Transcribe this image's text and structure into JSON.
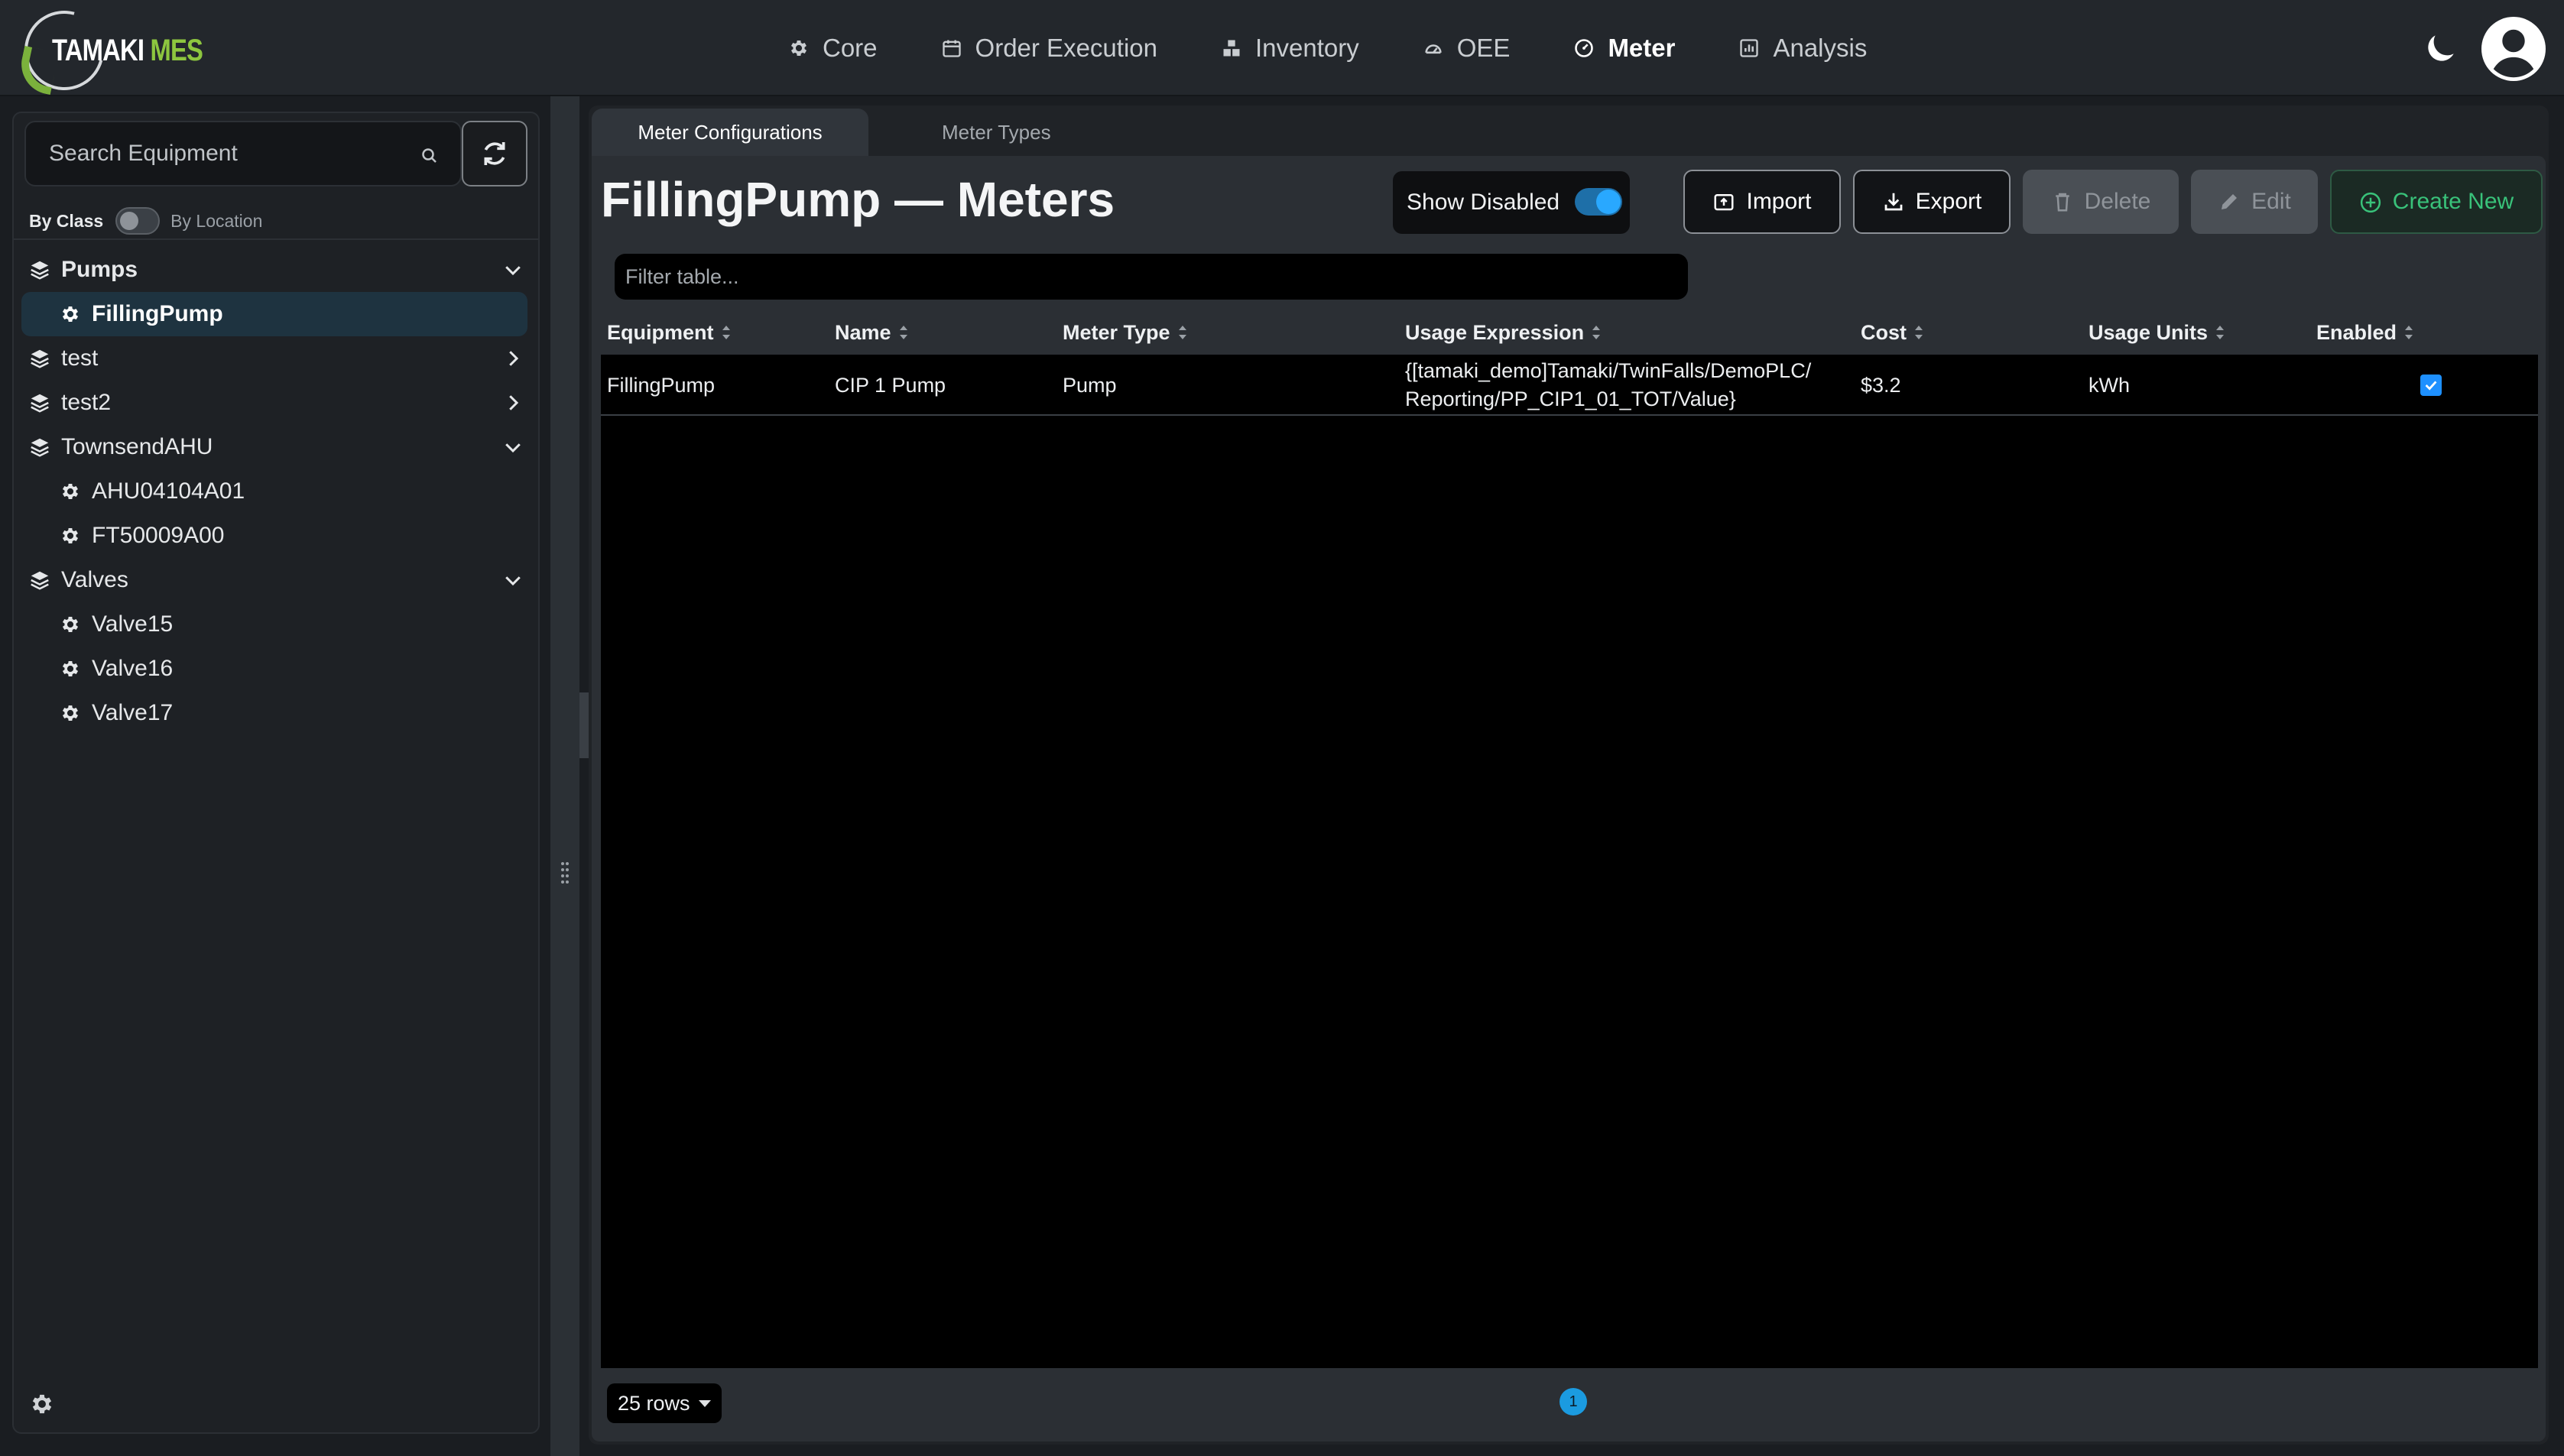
{
  "app": {
    "logo_part1": "TAMAKI",
    "logo_part2": "MES",
    "colors": {
      "brand_green": "#8dc63f",
      "accent_blue": "#29a8ff",
      "create_green": "#39c27a"
    }
  },
  "nav": {
    "items": [
      {
        "label": "Core",
        "icon": "gear-icon"
      },
      {
        "label": "Order Execution",
        "icon": "calendar-icon"
      },
      {
        "label": "Inventory",
        "icon": "boxes-icon"
      },
      {
        "label": "OEE",
        "icon": "gauge-icon"
      },
      {
        "label": "Meter",
        "icon": "meter-icon",
        "active": true
      },
      {
        "label": "Analysis",
        "icon": "chart-icon"
      }
    ]
  },
  "sidebar": {
    "search_placeholder": "Search Equipment",
    "by_class": "By Class",
    "by_location": "By Location",
    "tree": [
      {
        "label": "Pumps",
        "type": "group",
        "expanded": true
      },
      {
        "label": "FillingPump",
        "type": "leaf",
        "selected": true
      },
      {
        "label": "test",
        "type": "group",
        "expanded": false
      },
      {
        "label": "test2",
        "type": "group",
        "expanded": false
      },
      {
        "label": "TownsendAHU",
        "type": "group",
        "expanded": true
      },
      {
        "label": "AHU04104A01",
        "type": "leaf"
      },
      {
        "label": "FT50009A00",
        "type": "leaf"
      },
      {
        "label": "Valves",
        "type": "group",
        "expanded": true
      },
      {
        "label": "Valve15",
        "type": "leaf"
      },
      {
        "label": "Valve16",
        "type": "leaf"
      },
      {
        "label": "Valve17",
        "type": "leaf"
      }
    ]
  },
  "tabs": [
    {
      "label": "Meter Configurations",
      "active": true
    },
    {
      "label": "Meter Types",
      "active": false
    }
  ],
  "main": {
    "title": "FillingPump — Meters",
    "show_disabled_label": "Show Disabled",
    "show_disabled_on": true,
    "buttons": {
      "import": "Import",
      "export": "Export",
      "delete": "Delete",
      "edit": "Edit",
      "create": "Create New"
    },
    "filter_placeholder": "Filter table..."
  },
  "table": {
    "columns": [
      "Equipment",
      "Name",
      "Meter Type",
      "Usage Expression",
      "Cost",
      "Usage Units",
      "Enabled"
    ],
    "rows": [
      {
        "equipment": "FillingPump",
        "name": "CIP 1 Pump",
        "meter_type": "Pump",
        "expr_line1": "{[tamaki_demo]Tamaki/TwinFalls/DemoPLC/",
        "expr_line2": "Reporting/PP_CIP1_01_TOT/Value}",
        "cost": "$3.2",
        "units": "kWh",
        "enabled": true
      }
    ]
  },
  "footer": {
    "rows_per_page": "25 rows",
    "page": "1"
  }
}
